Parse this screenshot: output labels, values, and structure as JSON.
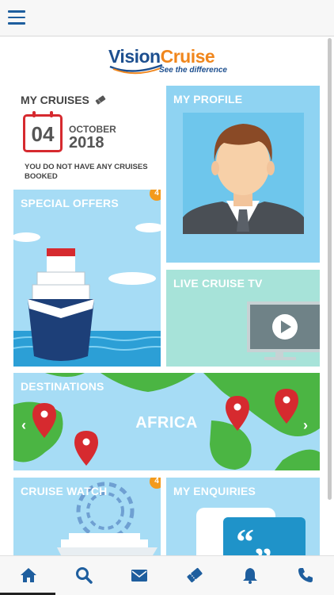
{
  "logo": {
    "brand_a": "Vision",
    "brand_b": "Cruise",
    "tagline": "See the difference"
  },
  "my_cruises": {
    "title": "MY CRUISES",
    "calendar_day": "04",
    "month": "OCTOBER",
    "year": "2018",
    "message": "YOU DO NOT HAVE ANY CRUISES BOOKED"
  },
  "tiles": {
    "my_profile": {
      "title": "MY PROFILE"
    },
    "special_offers": {
      "title": "SPECIAL OFFERS",
      "badge": "4"
    },
    "live_cruise_tv": {
      "title": "LIVE CRUISE TV"
    },
    "destinations": {
      "title": "DESTINATIONS",
      "current": "AFRICA",
      "prev": "‹",
      "next": "›"
    },
    "cruise_watch": {
      "title": "CRUISE WATCH",
      "badge": "4"
    },
    "my_enquiries": {
      "title": "MY ENQUIRIES"
    }
  },
  "colors": {
    "accent_blue": "#1e5e9e",
    "brand_orange": "#f0861c",
    "badge_orange": "#f39a1c",
    "calendar_red": "#d62a2f",
    "pin_red": "#d62a2f",
    "map_green": "#4bb543"
  },
  "bottom_nav": [
    {
      "icon": "home-icon"
    },
    {
      "icon": "search-icon"
    },
    {
      "icon": "envelope-icon"
    },
    {
      "icon": "ticket-icon"
    },
    {
      "icon": "bell-icon"
    },
    {
      "icon": "phone-icon"
    }
  ]
}
